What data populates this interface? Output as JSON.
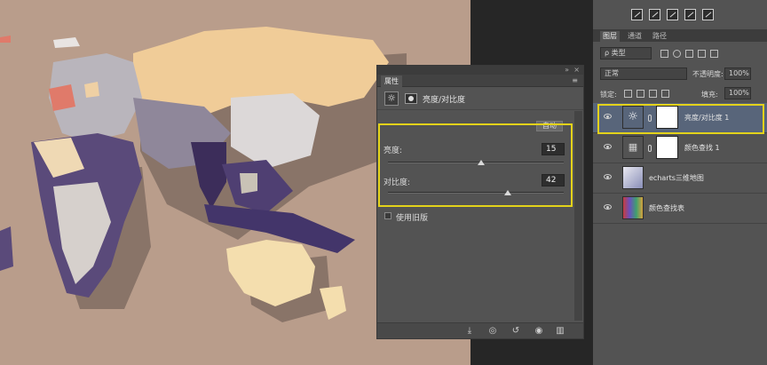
{
  "properties_panel": {
    "double_arrow": "»",
    "close": "×",
    "tab_label": "属性",
    "menu_icon": "menu-icon",
    "adjustment_title": "亮度/对比度",
    "auto_button": "自动",
    "brightness": {
      "label": "亮度:",
      "value": "15",
      "fraction": 0.53
    },
    "contrast": {
      "label": "对比度:",
      "value": "42",
      "fraction": 0.68
    },
    "legacy_label": "使用旧版",
    "footer_icons": [
      "clip-icon",
      "view-previous-icon",
      "reset-icon",
      "visibility-icon",
      "trash-icon"
    ]
  },
  "layers_panel": {
    "tabs": [
      "图层",
      "通道",
      "路径"
    ],
    "kind_filter": "ρ 类型",
    "blend_mode": "正常",
    "opacity_label": "不透明度:",
    "opacity_value": "100%",
    "lock_label": "锁定:",
    "fill_label": "填充:",
    "fill_value": "100%",
    "layers": [
      {
        "name": "亮度/对比度 1",
        "selected": true,
        "type": "adjustment"
      },
      {
        "name": "颜色查找 1",
        "selected": false,
        "type": "adjustment"
      },
      {
        "name": "echarts三维地图",
        "selected": false,
        "type": "image"
      },
      {
        "name": "颜色查找表",
        "selected": false,
        "type": "image"
      }
    ]
  },
  "colors": {
    "canvas_bg": "#b99d8b",
    "highlight": "#e3d21a",
    "selected_layer": "#58657a"
  }
}
